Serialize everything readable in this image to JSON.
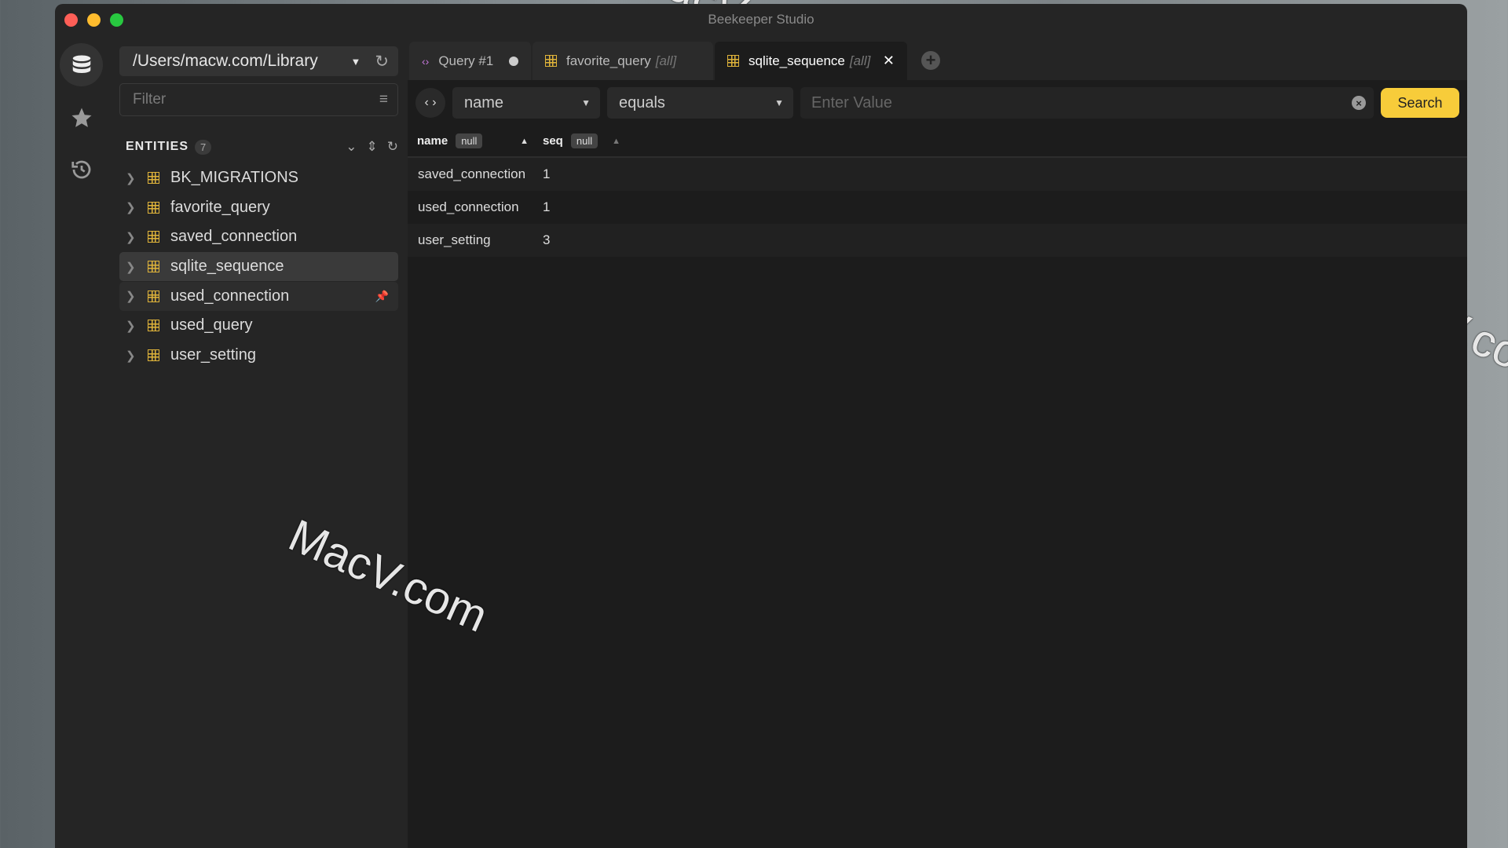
{
  "window": {
    "title": "Beekeeper Studio"
  },
  "connection": {
    "path": "/Users/macw.com/Library"
  },
  "filter": {
    "placeholder": "Filter"
  },
  "entities": {
    "label": "ENTITIES",
    "count": "7",
    "items": [
      {
        "name": "BK_MIGRATIONS"
      },
      {
        "name": "favorite_query"
      },
      {
        "name": "saved_connection"
      },
      {
        "name": "sqlite_sequence"
      },
      {
        "name": "used_connection"
      },
      {
        "name": "used_query"
      },
      {
        "name": "user_setting"
      }
    ]
  },
  "tabs": [
    {
      "label": "Query #1",
      "icon": "code-icon",
      "unsaved": true
    },
    {
      "label": "favorite_query",
      "suffix": "[all]",
      "icon": "table-icon"
    },
    {
      "label": "sqlite_sequence",
      "suffix": "[all]",
      "icon": "table-icon",
      "active": true
    }
  ],
  "filterbar": {
    "field": "name",
    "operator": "equals",
    "value_placeholder": "Enter Value",
    "search_label": "Search"
  },
  "table": {
    "columns": [
      {
        "name": "name",
        "badge": "null"
      },
      {
        "name": "seq",
        "badge": "null"
      }
    ],
    "rows": [
      [
        "saved_connection",
        "1"
      ],
      [
        "used_connection",
        "1"
      ],
      [
        "user_setting",
        "3"
      ]
    ]
  },
  "colors": {
    "accent": "#f7cc3a",
    "table_icon": "#e0b43a",
    "code_icon": "#c678dd"
  },
  "watermark": "MacV.com"
}
